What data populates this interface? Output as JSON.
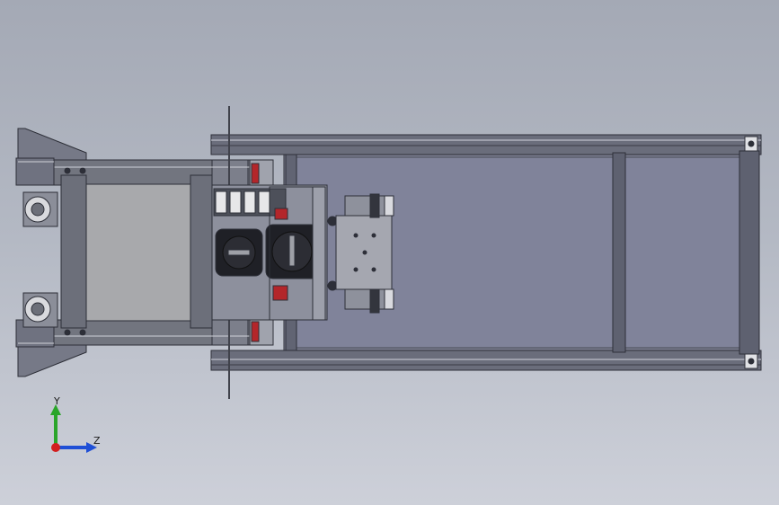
{
  "viewport": {
    "background_top": "#a4a9b5",
    "background_bottom": "#cdd0d9"
  },
  "model": {
    "description_icon": "cad-assembly-top-view",
    "frame_color": "#5c5f6b",
    "panel_color": "#7e8193",
    "light_panel_color": "#a7a8ac",
    "accent_red": "#b3262a"
  },
  "triad": {
    "y_label": "Y",
    "z_label": "Z",
    "y_color": "#2aa52a",
    "z_color": "#1f4fd6",
    "origin_color": "#d21e1e"
  }
}
